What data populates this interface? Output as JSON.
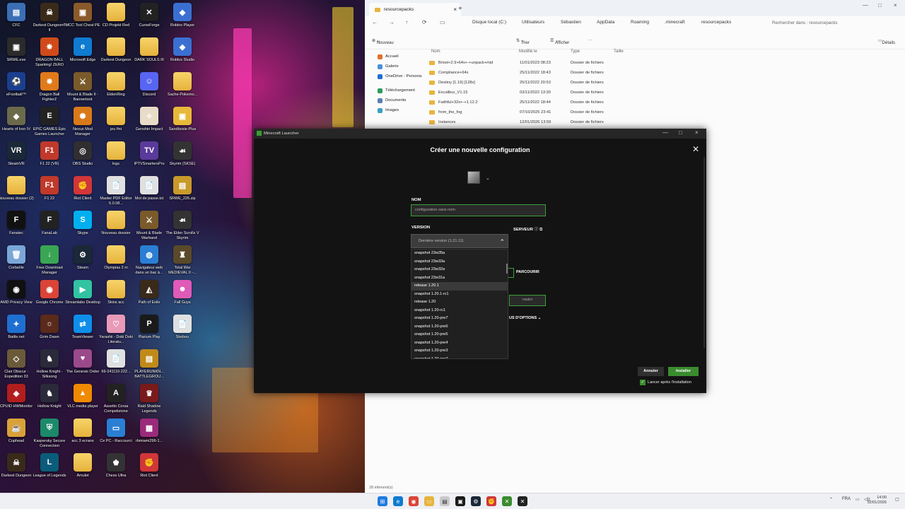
{
  "desktop": {
    "icons": [
      {
        "label": "CFC",
        "color": "#3b6fb5",
        "glyph": "▤"
      },
      {
        "label": "SRWE.exe",
        "color": "#2b2b2b",
        "glyph": "▣"
      },
      {
        "label": "eFootball™",
        "color": "#1a3f8f",
        "glyph": "⚽"
      },
      {
        "label": "Hearts of Iron IV",
        "color": "#6b6b4b",
        "glyph": "◆"
      },
      {
        "label": "SteamVR",
        "color": "#1b2838",
        "glyph": "VR"
      },
      {
        "label": "Nouveau dossier (2)",
        "color": "folder",
        "glyph": ""
      },
      {
        "label": "Fanatec",
        "color": "#111111",
        "glyph": "F"
      },
      {
        "label": "Corbeille",
        "color": "#7aa7d8",
        "glyph": "🗑"
      },
      {
        "label": "AMD Privacy View",
        "color": "#111111",
        "glyph": "◉"
      },
      {
        "label": "Battle.net",
        "color": "#1f6fd1",
        "glyph": "✦"
      },
      {
        "label": "Clair Obscur : Expedition 33",
        "color": "#6a5a3a",
        "glyph": "◇"
      },
      {
        "label": "CPUID HWMonitor",
        "color": "#b21e1e",
        "glyph": "◈"
      },
      {
        "label": "Cuphead",
        "color": "#d9a13a",
        "glyph": "☕"
      },
      {
        "label": "Darkest Dungeon",
        "color": "#3a2a1a",
        "glyph": "☠"
      },
      {
        "label": "Darkest Dungeon® II",
        "color": "#3a2a1a",
        "glyph": "☠"
      },
      {
        "label": "DRAGON BALL Sparking! ZERO",
        "color": "#d14b1a",
        "glyph": "✸"
      },
      {
        "label": "Dragon Ball FighterZ",
        "color": "#e07a1a",
        "glyph": "✸"
      },
      {
        "label": "EPIC GAMES Epic Games Launcher",
        "color": "#222222",
        "glyph": "E"
      },
      {
        "label": "F1 22 (VR)",
        "color": "#c0392b",
        "glyph": "F1"
      },
      {
        "label": "F1 22",
        "color": "#c0392b",
        "glyph": "F1"
      },
      {
        "label": "FanaLab",
        "color": "#222222",
        "glyph": "F"
      },
      {
        "label": "Free Download Manager",
        "color": "#3aa655",
        "glyph": "↓"
      },
      {
        "label": "Google Chrome",
        "color": "#db4437",
        "glyph": "◉"
      },
      {
        "label": "Grim Dawn",
        "color": "#5a2a1a",
        "glyph": "☼"
      },
      {
        "label": "Hollow Knight - Silksong",
        "color": "#2a2a3a",
        "glyph": "♞"
      },
      {
        "label": "Hollow Knight",
        "color": "#2a2a3a",
        "glyph": "♞"
      },
      {
        "label": "Kaspersky Secure Connection",
        "color": "#1c8a6a",
        "glyph": "⛨"
      },
      {
        "label": "League of Legends",
        "color": "#0b5c7a",
        "glyph": "L"
      },
      {
        "label": "MCC Tool Chest PE",
        "color": "#8b5a2b",
        "glyph": "▣"
      },
      {
        "label": "Microsoft Edge",
        "color": "#0f7bd1",
        "glyph": "e"
      },
      {
        "label": "Mount & Blade II - Bannerlord",
        "color": "#7a5a2a",
        "glyph": "⚔"
      },
      {
        "label": "Nexus Mod Manager",
        "color": "#d97a1a",
        "glyph": "✺"
      },
      {
        "label": "OBS Studio",
        "color": "#302e31",
        "glyph": "◎"
      },
      {
        "label": "Riot Client",
        "color": "#d13639",
        "glyph": "✊"
      },
      {
        "label": "Skype",
        "color": "#00aff0",
        "glyph": "S"
      },
      {
        "label": "Steam",
        "color": "#1b2838",
        "glyph": "⚙"
      },
      {
        "label": "Streamlabs Desktop",
        "color": "#31c3a2",
        "glyph": "▶"
      },
      {
        "label": "TeamViewer",
        "color": "#0e8ee9",
        "glyph": "⇄"
      },
      {
        "label": "The Genesis Order",
        "color": "#9a4a8a",
        "glyph": "♥"
      },
      {
        "label": "VLC media player",
        "color": "#f08a00",
        "glyph": "▲"
      },
      {
        "label": "acc 3 ecrans",
        "color": "folder",
        "glyph": ""
      },
      {
        "label": "Amulet",
        "color": "folder",
        "glyph": ""
      },
      {
        "label": "CD Projekt Red",
        "color": "folder",
        "glyph": ""
      },
      {
        "label": "Darkest Dungeon",
        "color": "folder",
        "glyph": ""
      },
      {
        "label": "EldenRing",
        "color": "folder",
        "glyph": ""
      },
      {
        "label": "jeu fini",
        "color": "folder",
        "glyph": ""
      },
      {
        "label": "logs",
        "color": "folder",
        "glyph": ""
      },
      {
        "label": "Master PDF Editor 5.0.08...",
        "color": "#e0e0e0",
        "glyph": "📄"
      },
      {
        "label": "Nouveau dossier",
        "color": "folder",
        "glyph": ""
      },
      {
        "label": "Olympias 2 m",
        "color": "folder",
        "glyph": ""
      },
      {
        "label": "Skins acc",
        "color": "folder",
        "glyph": ""
      },
      {
        "label": "Yarashii - Doki Doki Literatu...",
        "color": "#e89ab8",
        "glyph": "♡"
      },
      {
        "label": "69-241110-222...",
        "color": "#e0e0e0",
        "glyph": "📄"
      },
      {
        "label": "Assetto Corsa Competizione",
        "color": "#222222",
        "glyph": "A"
      },
      {
        "label": "Ce PC - Raccourci",
        "color": "#2a7fd4",
        "glyph": "▭"
      },
      {
        "label": "Chess Ultra",
        "color": "#333333",
        "glyph": "♚"
      },
      {
        "label": "CurseForge",
        "color": "#222222",
        "glyph": "✕"
      },
      {
        "label": "DARK SOULS III",
        "color": "folder",
        "glyph": ""
      },
      {
        "label": "Discord",
        "color": "#5865f2",
        "glyph": "☺"
      },
      {
        "label": "Genshin Impact",
        "color": "#e8dcc8",
        "glyph": "✧"
      },
      {
        "label": "IPTVSmartersPro",
        "color": "#5a3a9a",
        "glyph": "TV"
      },
      {
        "label": "Mot de passe.txt",
        "color": "#e0e0e0",
        "glyph": "📄"
      },
      {
        "label": "Mount & Blade Warband",
        "color": "#7a5a2a",
        "glyph": "⚔"
      },
      {
        "label": "Navigateur web dans un bac à...",
        "color": "#2a7fd4",
        "glyph": "◍"
      },
      {
        "label": "Path of Exile",
        "color": "#3a2a1a",
        "glyph": "◭"
      },
      {
        "label": "Plarium Play",
        "color": "#1a1a1a",
        "glyph": "P"
      },
      {
        "label": "PLAYERUNKN... BATTLEGROU...",
        "color": "#c08a1a",
        "glyph": "▤"
      },
      {
        "label": "Raid Shadow Legends",
        "color": "#7a1a1a",
        "glyph": "♛"
      },
      {
        "label": "rbmiami296-1...",
        "color": "#9a2a7a",
        "glyph": "▦"
      },
      {
        "label": "Riot Client",
        "color": "#d13639",
        "glyph": "✊"
      },
      {
        "label": "Roblox Player",
        "color": "#3a6fd1",
        "glyph": "◆"
      },
      {
        "label": "Roblox Studio",
        "color": "#3a6fd1",
        "glyph": "◆"
      },
      {
        "label": "Sache-Pokemo...",
        "color": "folder",
        "glyph": ""
      },
      {
        "label": "Sandboxie-Plus",
        "color": "#e8b83a",
        "glyph": "▣"
      },
      {
        "label": "Skyrim (SKSE)",
        "color": "#333333",
        "glyph": "☙"
      },
      {
        "label": "SRWE_226.zip",
        "color": "#c89a2a",
        "glyph": "▤"
      },
      {
        "label": "The Elder Scrolls V Skyrim",
        "color": "#333333",
        "glyph": "☙"
      },
      {
        "label": "Total War MEDIEVAL II -...",
        "color": "#5a4a2a",
        "glyph": "♜"
      },
      {
        "label": "Fall Guys",
        "color": "#e05ab8",
        "glyph": "☻"
      },
      {
        "label": "Skebeu",
        "color": "#e0e0e0",
        "glyph": "📄"
      }
    ]
  },
  "explorer": {
    "tab_title": "resourcepacks",
    "breadcrumb": [
      "Disque local (C:)",
      "Utilisateurs",
      "Sébastien",
      "AppData",
      "Roaming",
      ".minecraft",
      "resourcepacks"
    ],
    "search_placeholder": "Rechercher dans : resourcepacks",
    "commands": {
      "new": "Nouveau",
      "sort": "Trier",
      "view": "Afficher",
      "details": "Détails"
    },
    "sidebar": [
      "Accueil",
      "Galerie",
      "OneDrive - Persona",
      "Téléchargement",
      "Documents",
      "Images"
    ],
    "columns": {
      "name": "Nom",
      "modified": "Modifié le",
      "type": "Type",
      "size": "Taille"
    },
    "rows": [
      {
        "name": "Brixel+2.9+64x+-+unpack+mid",
        "modified": "11/01/2023 08:23",
        "type": "Dossier de fichiers"
      },
      {
        "name": "Compliance+64x",
        "modified": "25/11/2022 18:43",
        "type": "Dossier de fichiers"
      },
      {
        "name": "Destiny [1.19] [128x]",
        "modified": "25/11/2022 20:53",
        "type": "Dossier de fichiers"
      },
      {
        "name": "Excalibur_V1.15",
        "modified": "03/11/2022 13:30",
        "type": "Dossier de fichiers"
      },
      {
        "name": "Faithful+32x+-+1.12.2",
        "modified": "25/11/2022 18:44",
        "type": "Dossier de fichiers"
      },
      {
        "name": "from_the_fog",
        "modified": "07/10/2025 23:41",
        "type": "Dossier de fichiers"
      },
      {
        "name": "Instances",
        "modified": "12/01/2026 13:59",
        "type": "Dossier de fichiers"
      }
    ],
    "status": "28 élément(s)"
  },
  "launcher": {
    "window_title": "Minecraft Launcher",
    "heading": "Créer une nouvelle configuration",
    "name_label": "NOM",
    "name_placeholder": "configuration sans nom",
    "version_label": "VERSION",
    "version_value": "Dernière version (1.21.11)",
    "server_label": "SERVEUR",
    "browse_label": "PARCOURIR",
    "resolution_placeholder": "<auto>",
    "more_options": "US D'OPTIONS",
    "version_options": [
      "snapshot 23w35a",
      "snapshot 23w33a",
      "snapshot 23w32a",
      "snapshot 23w31a",
      "release 1.20.1",
      "snapshot 1.20.1-rc1",
      "release 1.20",
      "snapshot 1.20-rc1",
      "snapshot 1.20-pre7",
      "snapshot 1.20-pre6",
      "snapshot 1.20-pre5",
      "snapshot 1.20-pre4",
      "snapshot 1.20-pre3",
      "snapshot 1.20-pre2"
    ],
    "hovered_option": "release 1.20.1",
    "cancel_label": "Annuler",
    "install_label": "Installer",
    "launch_after_label": "Lancer après l'installation",
    "launch_after_checked": true
  },
  "taskbar": {
    "language": "FRA",
    "time": "14:00",
    "date": "12/01/2026"
  }
}
